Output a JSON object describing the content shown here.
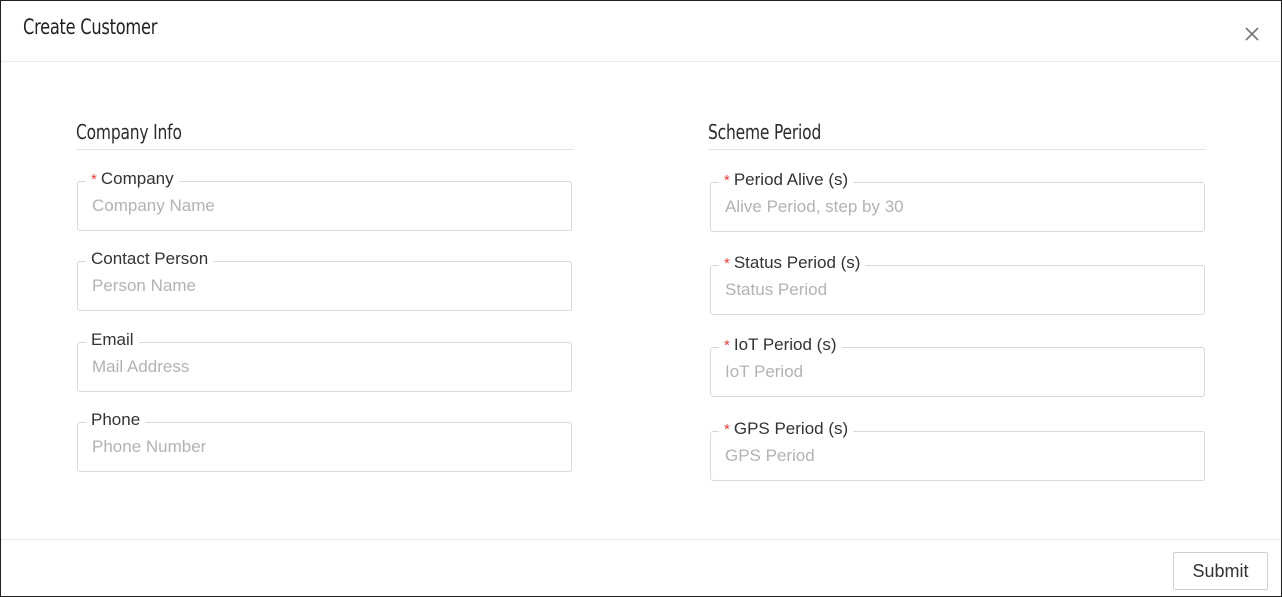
{
  "dialog": {
    "title": "Create Customer"
  },
  "company_info": {
    "title": "Company Info",
    "fields": [
      {
        "label": "Company",
        "required": true,
        "placeholder": "Company Name",
        "value": ""
      },
      {
        "label": "Contact Person",
        "required": false,
        "placeholder": "Person Name",
        "value": ""
      },
      {
        "label": "Email",
        "required": false,
        "placeholder": "Mail Address",
        "value": ""
      },
      {
        "label": "Phone",
        "required": false,
        "placeholder": "Phone Number",
        "value": ""
      }
    ]
  },
  "scheme_period": {
    "title": "Scheme Period",
    "fields": [
      {
        "label": "Period Alive (s)",
        "required": true,
        "placeholder": "Alive Period, step by 30",
        "value": ""
      },
      {
        "label": "Status Period (s)",
        "required": true,
        "placeholder": "Status Period",
        "value": ""
      },
      {
        "label": "IoT Period (s)",
        "required": true,
        "placeholder": "IoT Period",
        "value": ""
      },
      {
        "label": "GPS Period (s)",
        "required": true,
        "placeholder": "GPS Period",
        "value": ""
      }
    ]
  },
  "footer": {
    "submit_label": "Submit"
  },
  "icons": {
    "close": "close-icon"
  }
}
